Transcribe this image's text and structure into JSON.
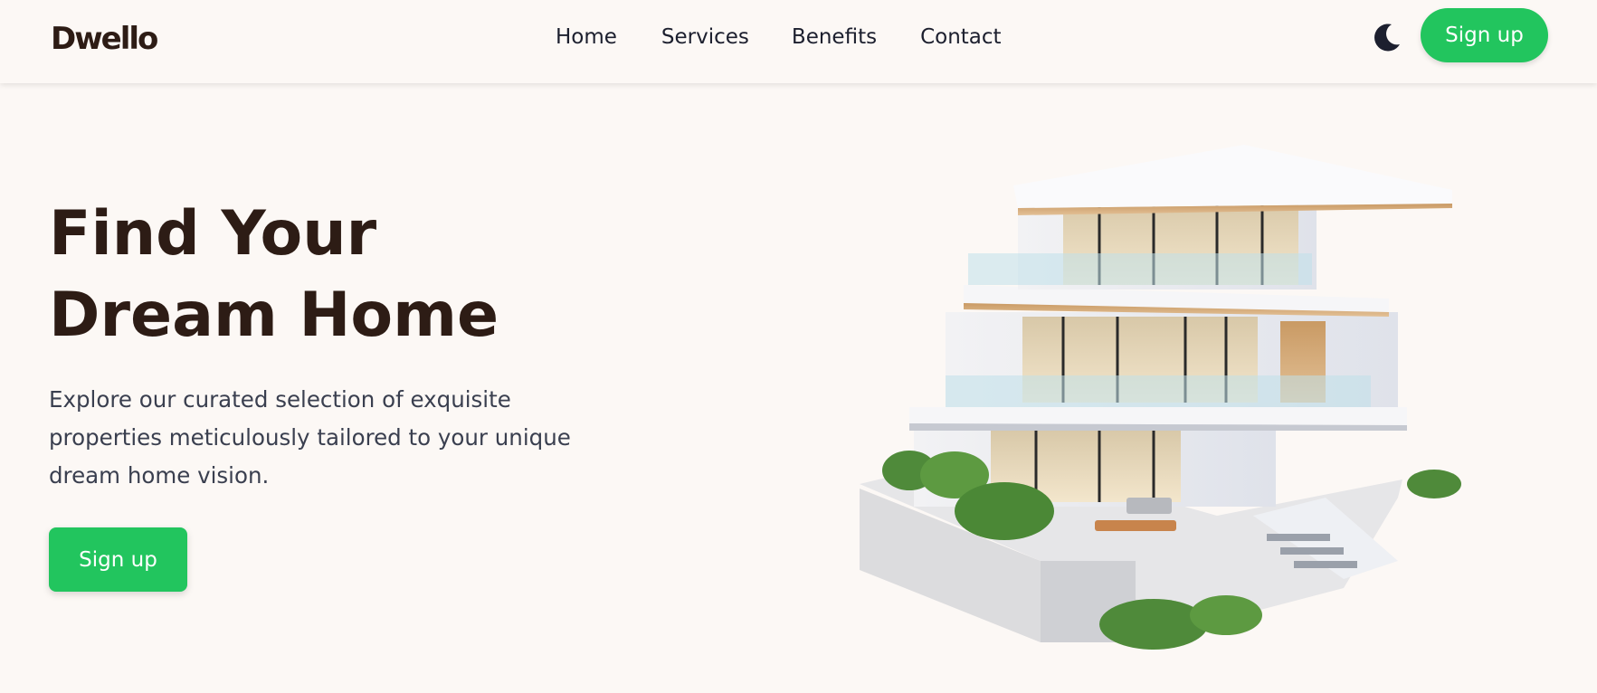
{
  "header": {
    "logo": "Dwello",
    "nav": [
      {
        "label": "Home"
      },
      {
        "label": "Services"
      },
      {
        "label": "Benefits"
      },
      {
        "label": "Contact"
      }
    ],
    "theme_toggle_icon": "moon-icon",
    "signup_label": "Sign up"
  },
  "hero": {
    "title_line1": "Find Your",
    "title_line2": "Dream Home",
    "description": "Explore our curated selection of exquisite properties meticulously tailored to your unique dream home vision.",
    "signup_label": "Sign up",
    "image": "modern-house-illustration"
  },
  "colors": {
    "background": "#fcf8f5",
    "accent": "#22c55e",
    "heading": "#2d1c15",
    "nav_text": "#1c1f2e"
  }
}
